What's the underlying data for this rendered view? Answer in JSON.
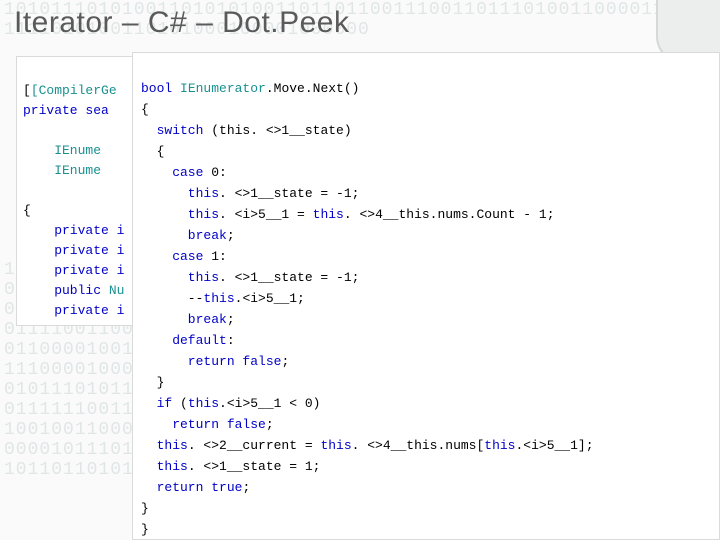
{
  "title": "Iterator – C# – Dot.Peek",
  "left_code": {
    "l1": {
      "attr": "[CompilerGe"
    },
    "l2": {
      "k1": "private",
      "k2": " sea"
    },
    "l3": "",
    "l4": {
      "t": "    IEnume"
    },
    "l5": {
      "t": "    IEnume"
    },
    "l6": "",
    "l7": "{",
    "l8": {
      "k": "    private",
      "v": " i"
    },
    "l9": {
      "k": "    private",
      "v": " i"
    },
    "l10": {
      "k": "    private",
      "v": " i"
    },
    "l11": {
      "k": "    public",
      "t": " Nu"
    },
    "l12": {
      "k": "    private",
      "v": " i"
    }
  },
  "right_code": {
    "l1": {
      "k1": "bool",
      "t1": " IEnumerator",
      "m": ".Move.Next()"
    },
    "l2": "{",
    "l3": {
      "k": "  switch",
      "r": " (this. <>1__state)"
    },
    "l4": "  {",
    "l5": {
      "k": "    case",
      "r": " 0:"
    },
    "l6": {
      "k": "      this",
      "r": ". <>1__state = -1;"
    },
    "l7": {
      "k": "      this",
      "mid": ". <i>5__1 = ",
      "k2": "this",
      "r2": ". <>4__this.nums.Count - 1;"
    },
    "l8": {
      "k": "      break",
      "r": ";"
    },
    "l9": {
      "k": "    case",
      "r": " 1:"
    },
    "l10": {
      "k": "      this",
      "r": ". <>1__state = -1;"
    },
    "l11": {
      "pre": "      --",
      "k": "this",
      "r": ".<i>5__1;"
    },
    "l12": {
      "k": "      break",
      "r": ";"
    },
    "l13": {
      "k": "    default",
      "r": ":"
    },
    "l14": {
      "k": "      return",
      "k2": " false",
      "r": ";"
    },
    "l15": "  }",
    "l16": {
      "k": "  if",
      "mid": " (",
      "k2": "this",
      "r": ".<i>5__1 < 0)"
    },
    "l17": {
      "k": "    return",
      "k2": " false",
      "r": ";"
    },
    "l18": {
      "k": "  this",
      "mid": ". <>2__current = ",
      "k2": "this",
      "mid2": ". <>4__this.nums[",
      "k3": "this",
      "r": ".<i>5__1];"
    },
    "l19": {
      "k": "  this",
      "r": ". <>1__state = 1;"
    },
    "l20": {
      "k": "  return",
      "k2": " true",
      "r": ";"
    },
    "l21": "}",
    "l22": "}"
  },
  "bg_bits": "1010111010100110101010011011011001110011011101001100001111111011001000100\n1111010100110101000100001000000\n\n\n\n\n\n\n\n\n\n\n\n111101011010\n011010010110101\n0101100100101\n0111100110000\n011000010010111\n1110000100011\n0101110101100\n0111111001110\n1001001100001\n0000101110111\n101101101011"
}
